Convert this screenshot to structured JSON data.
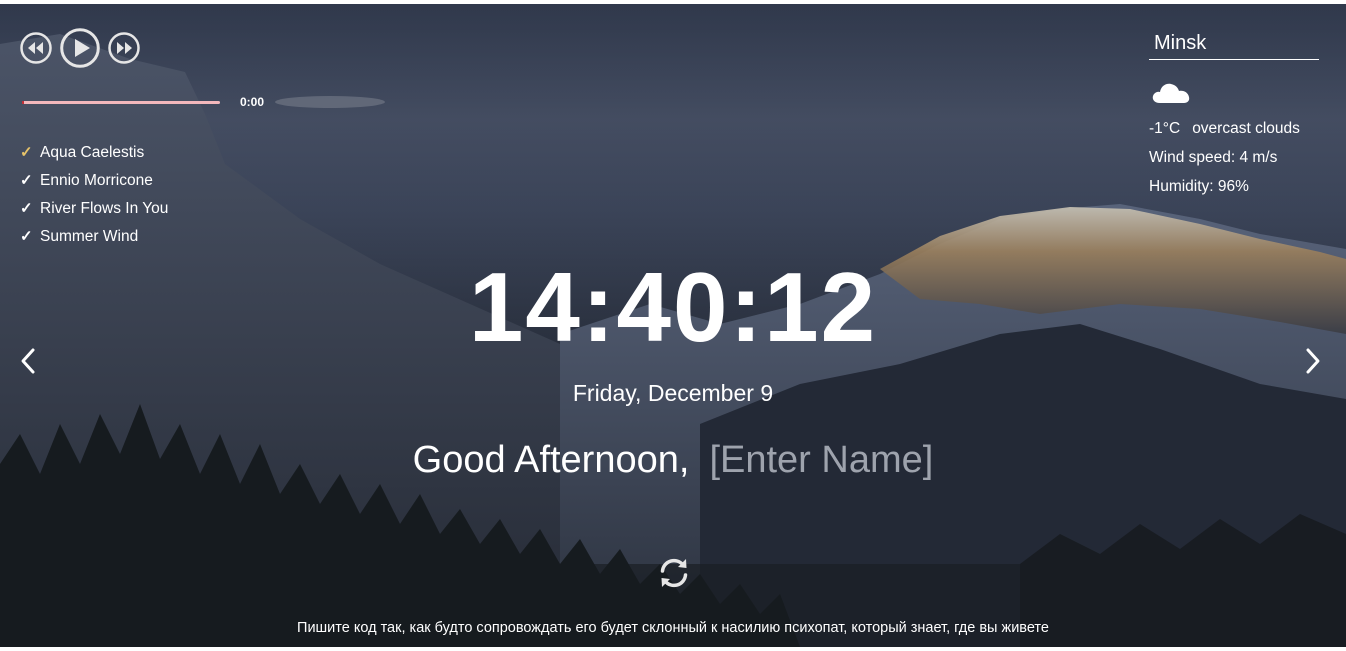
{
  "player": {
    "time": "0:00",
    "progress": 0.01,
    "tracks": [
      {
        "title": "Aqua Caelestis",
        "active": true
      },
      {
        "title": "Ennio Morricone",
        "active": false
      },
      {
        "title": "River Flows In You",
        "active": false
      },
      {
        "title": "Summer Wind",
        "active": false
      }
    ],
    "check_mark": "✓"
  },
  "weather": {
    "city": "Minsk",
    "icon": "cloud-icon",
    "temperature": "-1°C",
    "description": "overcast clouds",
    "wind": "Wind speed: 4 m/s",
    "humidity": "Humidity: 96%"
  },
  "clock": {
    "time": "14:40:12",
    "date": "Friday, December 9"
  },
  "greeting": {
    "text": "Good Afternoon,",
    "name_placeholder": "[Enter Name]"
  },
  "quote": {
    "text": "Пишите код так, как будто сопровождать его будет склонный к насилию психопат, который знает, где вы живете"
  },
  "colors": {
    "progress_track": "#f3b8bc",
    "progress_fill": "#c03038",
    "active_check": "#e6c36a",
    "placeholder": "#9ea3ad"
  }
}
